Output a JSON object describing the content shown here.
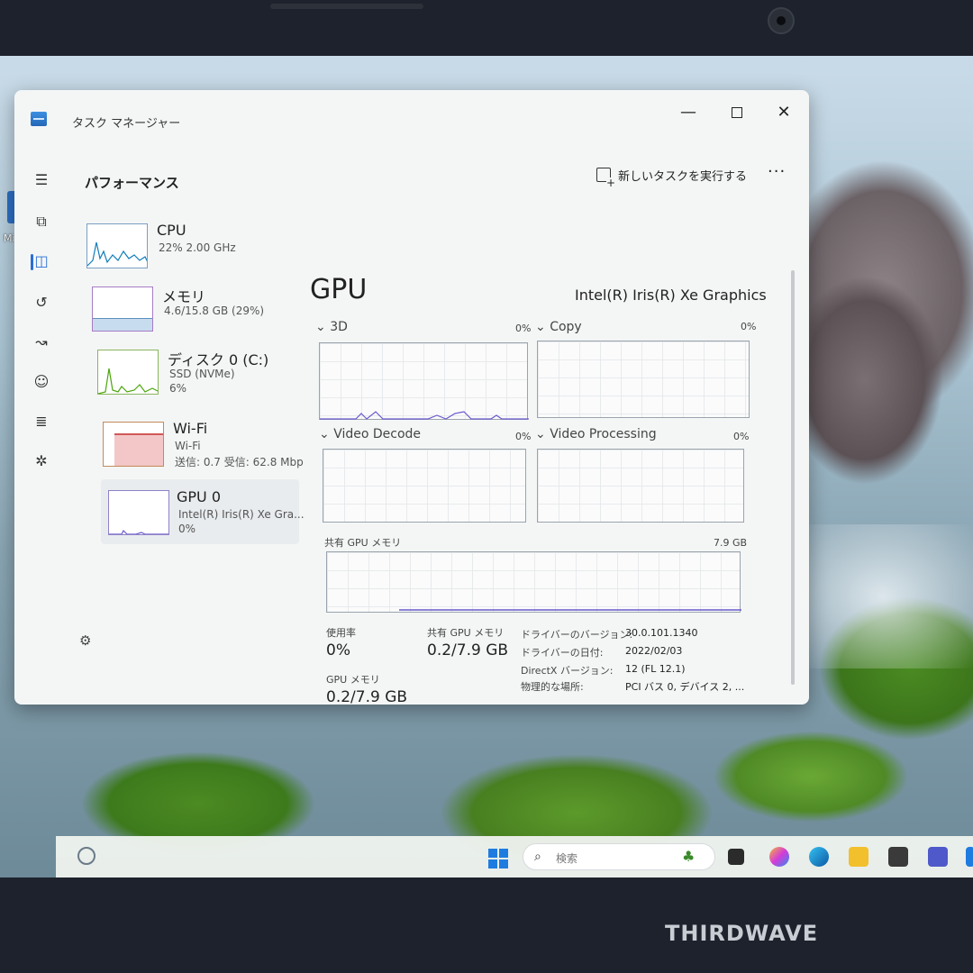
{
  "window": {
    "title": "タスク マネージャー",
    "min_label": "—",
    "close_label": "✕"
  },
  "header": {
    "page_title": "パフォーマンス",
    "new_task_label": "新しいタスクを実行する",
    "more_label": "···"
  },
  "devices": [
    {
      "name": "CPU",
      "sub1": "22% 2.00 GHz",
      "sub2": "",
      "sub3": ""
    },
    {
      "name": "メモリ",
      "sub1": "4.6/15.8 GB (29%)",
      "sub2": "",
      "sub3": ""
    },
    {
      "name": "ディスク 0 (C:)",
      "sub1": "SSD (NVMe)",
      "sub2": "6%",
      "sub3": ""
    },
    {
      "name": "Wi-Fi",
      "sub1": "Wi-Fi",
      "sub2": "送信: 0.7 受信: 62.8 Mbp",
      "sub3": ""
    },
    {
      "name": "GPU 0",
      "sub1": "Intel(R) Iris(R) Xe Gra...",
      "sub2": "0%",
      "sub3": ""
    }
  ],
  "detail": {
    "title": "GPU",
    "model": "Intel(R) Iris(R) Xe Graphics",
    "engines": [
      {
        "label": "3D",
        "pct": "0%"
      },
      {
        "label": "Copy",
        "pct": "0%"
      },
      {
        "label": "Video Decode",
        "pct": "0%"
      },
      {
        "label": "Video Processing",
        "pct": "0%"
      }
    ],
    "shared_mem_label": "共有 GPU メモリ",
    "shared_mem_max": "7.9 GB",
    "stats": {
      "usage_label": "使用率",
      "usage_value": "0%",
      "shared_label": "共有 GPU メモリ",
      "shared_value": "0.2/7.9 GB",
      "gpumem_label": "GPU メモリ",
      "gpumem_value": "0.2/7.9 GB"
    },
    "info": [
      {
        "label": "ドライバーのバージョン:",
        "value": "30.0.101.1340"
      },
      {
        "label": "ドライバーの日付:",
        "value": "2022/02/03"
      },
      {
        "label": "DirectX バージョン:",
        "value": "12 (FL 12.1)"
      },
      {
        "label": "物理的な場所:",
        "value": "PCI バス 0, デバイス 2, ..."
      }
    ]
  },
  "desktop": {
    "icon_label": "Micr"
  },
  "taskbar": {
    "search_placeholder": "検索"
  },
  "bezel": {
    "brand": "THIRDWAVE"
  },
  "colors": {
    "accent": "#2a6fd6",
    "cpu_graph": "#117dbb",
    "memory_graph": "#8b12ae",
    "disk_graph": "#4da60c",
    "wifi_graph": "#a74f01",
    "gpu_graph": "#6a5acd"
  }
}
